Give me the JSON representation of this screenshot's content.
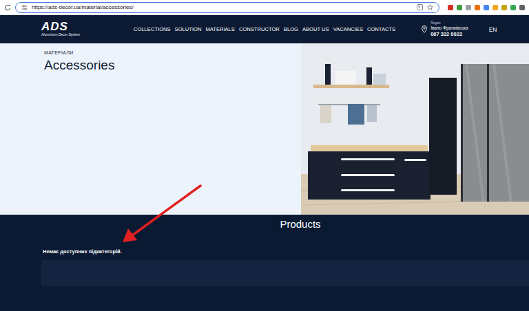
{
  "browser": {
    "url": "https://ads-decor.ua/material/accessories/"
  },
  "header": {
    "logo": "ADS",
    "logo_subtitle": "Aluminium Decor System",
    "nav": [
      "COLLECTIONS",
      "SOLUTION",
      "MATERIALS",
      "CONSTRUCTOR",
      "BLOG",
      "ABOUT US",
      "VACANCIES",
      "CONTACTS"
    ],
    "region_label": "Region",
    "region_city": "Івано Франківська",
    "phone": "067 322 0022",
    "language": "EN"
  },
  "hero": {
    "breadcrumb": "МАТЕРІАЛИ",
    "title": "Accessories"
  },
  "products": {
    "heading": "Products",
    "empty_message": "Немає доступних підкатегорій."
  }
}
